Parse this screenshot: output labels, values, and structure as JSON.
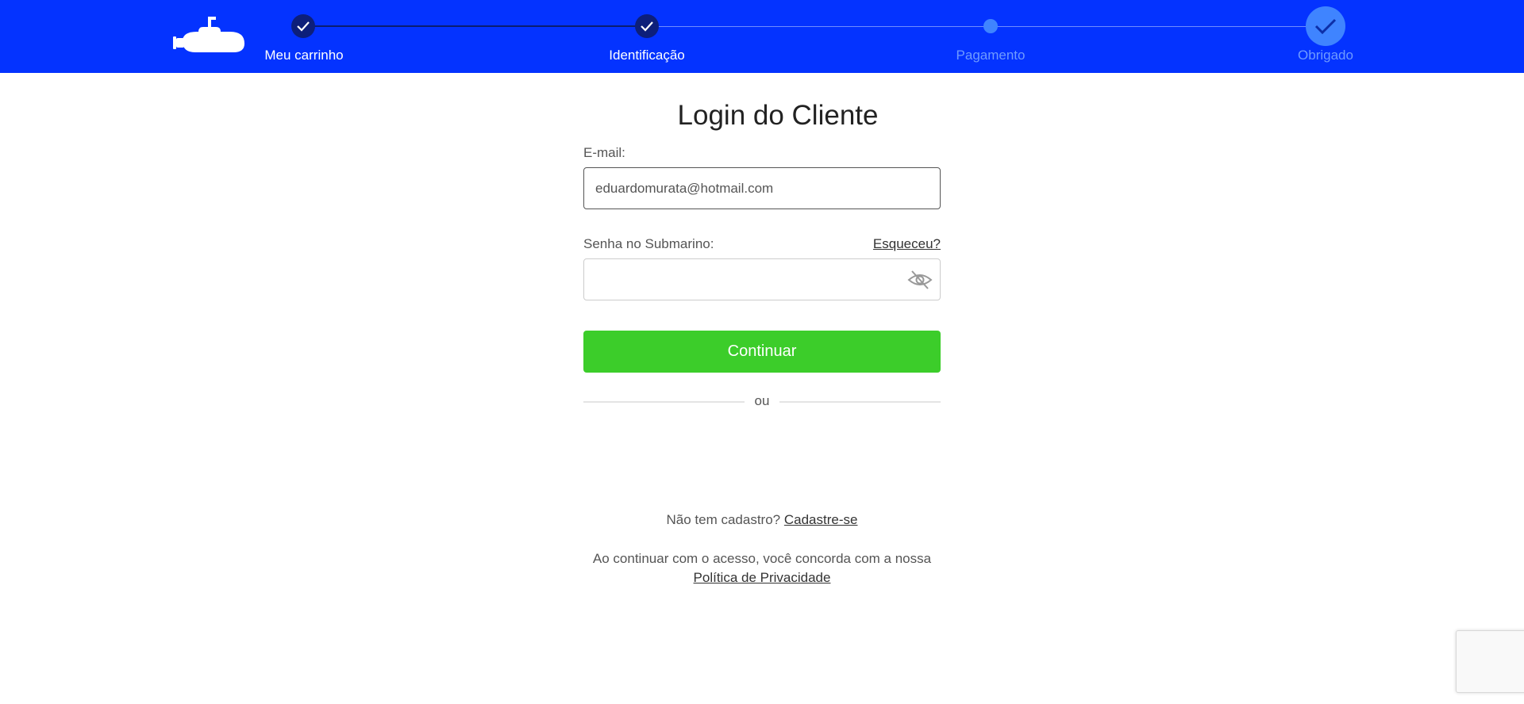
{
  "header": {
    "logo_icon": "submarine-icon",
    "steps": [
      {
        "label": "Meu carrinho",
        "status": "done"
      },
      {
        "label": "Identificação",
        "status": "done"
      },
      {
        "label": "Pagamento",
        "status": "pending"
      },
      {
        "label": "Obrigado",
        "status": "pending"
      }
    ]
  },
  "login": {
    "title": "Login do Cliente",
    "email_label": "E-mail:",
    "email_value": "eduardomurata@hotmail.com",
    "password_label": "Senha no Submarino:",
    "forgot_link": "Esqueceu?",
    "password_value": "",
    "toggle_icon": "eye-slash-icon",
    "continue_label": "Continuar",
    "divider_text": "ou"
  },
  "footer": {
    "signup_prompt": "Não tem cadastro?",
    "signup_link": "Cadastre-se",
    "terms_text": "Ao continuar com o acesso, você concorda com a nossa",
    "privacy_link": "Política de Privacidade"
  },
  "colors": {
    "header_bg": "#0433ff",
    "step_done": "#0d1f7a",
    "step_pending": "#3f84ff",
    "button_bg": "#3ccd2a"
  }
}
